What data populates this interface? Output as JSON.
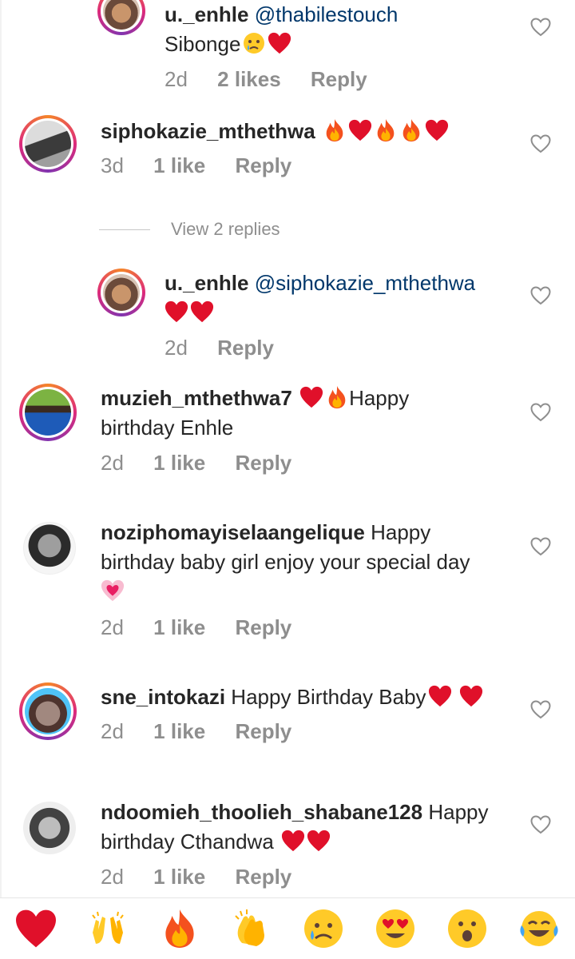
{
  "comments": [
    {
      "username": "u._enhle",
      "mention": "@thabilestouch",
      "text": "Sibonge",
      "time": "2d",
      "likes": "2 likes",
      "reply": "Reply"
    },
    {
      "username": "siphokazie_mthethwa",
      "text": "",
      "time": "3d",
      "likes": "1 like",
      "reply": "Reply"
    },
    {
      "username": "u._enhle",
      "mention": "@siphokazie_mthethwa",
      "text": "",
      "time": "2d",
      "reply": "Reply"
    },
    {
      "username": "muzieh_mthethwa7",
      "text": "Happy",
      "text2": "birthday Enhle",
      "time": "2d",
      "likes": "1 like",
      "reply": "Reply"
    },
    {
      "username": "noziphomayiselaangelique",
      "text": "Happy",
      "text2": "birthday baby girl enjoy your special day",
      "time": "2d",
      "likes": "1 like",
      "reply": "Reply"
    },
    {
      "username": "sne_intokazi",
      "text": "Happy Birthday Baby",
      "time": "2d",
      "likes": "1 like",
      "reply": "Reply"
    },
    {
      "username": "ndoomieh_thoolieh_shabane128",
      "text": "Happy",
      "text2": "birthday Cthandwa",
      "time": "2d",
      "likes": "1 like",
      "reply": "Reply"
    }
  ],
  "view_replies": "View 2 replies",
  "reactions": [
    "heart",
    "raising-hands",
    "fire",
    "clapping-hands",
    "sad-tear",
    "heart-eyes",
    "surprised",
    "tears-of-joy"
  ],
  "colors": {
    "mention": "#00376b",
    "meta": "#8e8e8e",
    "heart": "#e0102a",
    "ring_start": "#f58529",
    "ring_end": "#8134af"
  }
}
